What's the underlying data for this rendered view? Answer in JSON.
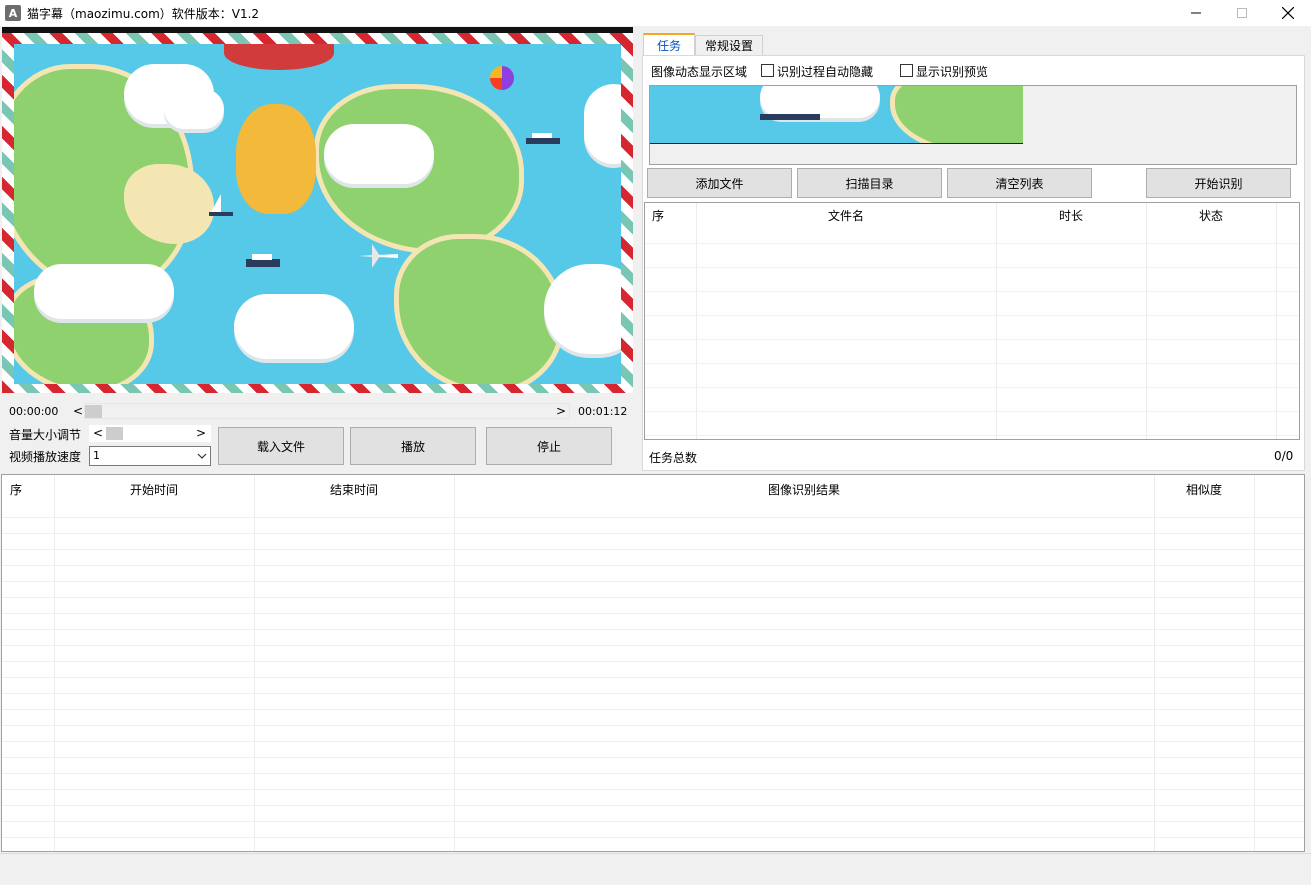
{
  "window": {
    "app_icon_letter": "A",
    "title": "猫字幕（maozimu.com）软件版本：V1.2"
  },
  "player": {
    "current_time": "00:00:00",
    "total_time": "00:01:12",
    "seek_position": 0,
    "volume_label": "音量大小调节",
    "speed_label": "视频播放速度",
    "speed_value": "1",
    "load_button": "载入文件",
    "play_button": "播放",
    "stop_button": "停止"
  },
  "tabs": [
    {
      "label": "任务",
      "active": true
    },
    {
      "label": "常规设置",
      "active": false
    }
  ],
  "task_panel": {
    "region_label": "图像动态显示区域",
    "auto_hide_label": "识别过程自动隐藏",
    "auto_hide_checked": false,
    "show_preview_label": "显示识别预览",
    "show_preview_checked": false,
    "buttons": {
      "add_file": "添加文件",
      "scan_dir": "扫描目录",
      "clear_list": "清空列表",
      "start": "开始识别"
    },
    "columns": [
      "序",
      "文件名",
      "时长",
      "状态"
    ],
    "rows": [],
    "total_label": "任务总数",
    "total_value": "0/0"
  },
  "results": {
    "columns": [
      "序",
      "开始时间",
      "结束时间",
      "图像识别结果",
      "相似度"
    ],
    "rows": []
  },
  "colors": {
    "active_tab_text": "#0050c8",
    "active_tab_accent": "#f5a623",
    "video_sea": "#56c8e8",
    "video_border_red": "#d6262f",
    "video_border_green": "#7ac6b4"
  }
}
